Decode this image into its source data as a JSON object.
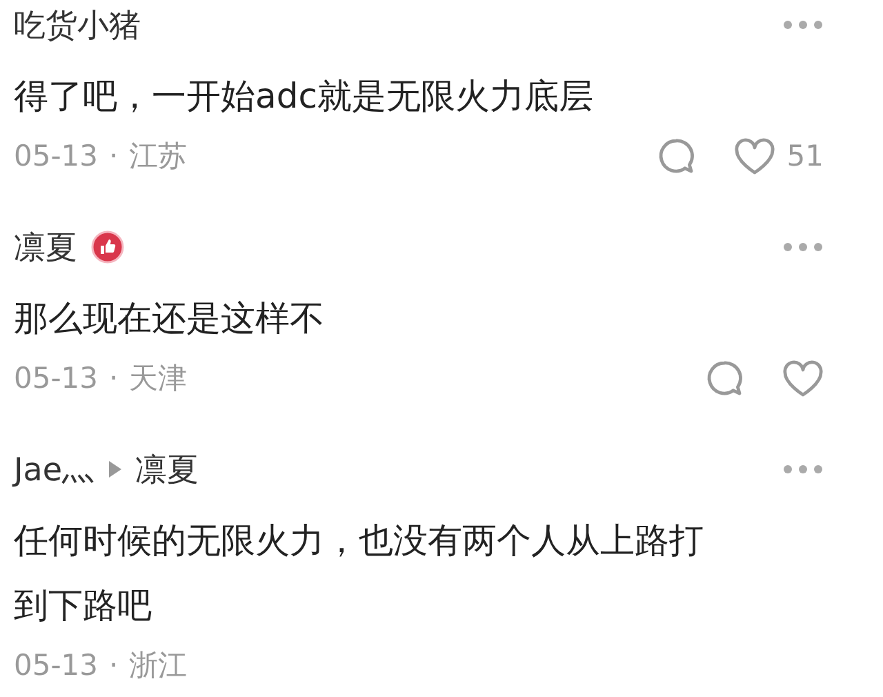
{
  "comments": [
    {
      "author": "吃货小猪",
      "liked_badge": false,
      "body": "得了吧，一开始adc就是无限火力底层",
      "date": "05-13",
      "separator": "·",
      "location": "江苏",
      "has_actions": true,
      "likes": "51"
    },
    {
      "author": "凛夏",
      "liked_badge": true,
      "body": "那么现在还是这样不",
      "date": "05-13",
      "separator": "·",
      "location": "天津",
      "has_actions": true
    },
    {
      "author": "Jae灬",
      "reply_to": "凛夏",
      "liked_badge": false,
      "body": "任何时候的无限火力，也没有两个人从上路打到下路吧",
      "date": "05-13",
      "separator": "·",
      "location": "浙江",
      "has_actions": false
    }
  ]
}
